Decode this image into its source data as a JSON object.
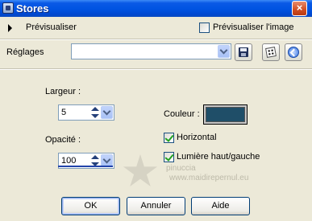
{
  "window": {
    "title": "Stores",
    "close_glyph": "×"
  },
  "preview": {
    "label": "Prévisualiser",
    "image_label": "Prévisualiser l'image",
    "image_checked": false
  },
  "settings": {
    "label": "Réglages",
    "preset_value": ""
  },
  "params": {
    "width_label": "Largeur :",
    "width_value": "5",
    "opacity_label": "Opacité :",
    "opacity_value": "100",
    "color_label": "Couleur :",
    "color_value": "#1f4e68",
    "horizontal_label": "Horizontal",
    "horizontal_checked": true,
    "light_label": "Lumière haut/gauche",
    "light_checked": true
  },
  "watermark": {
    "line1": "pinuccia",
    "line2": "www.maidirepernul.eu"
  },
  "buttons": {
    "ok": "OK",
    "cancel": "Annuler",
    "help": "Aide"
  },
  "icons": {
    "title": "stores-app-icon",
    "preview_toggle": "triangle-right-icon",
    "save": "floppy-disk-icon",
    "random": "dice-icon",
    "reset": "reset-icon"
  }
}
